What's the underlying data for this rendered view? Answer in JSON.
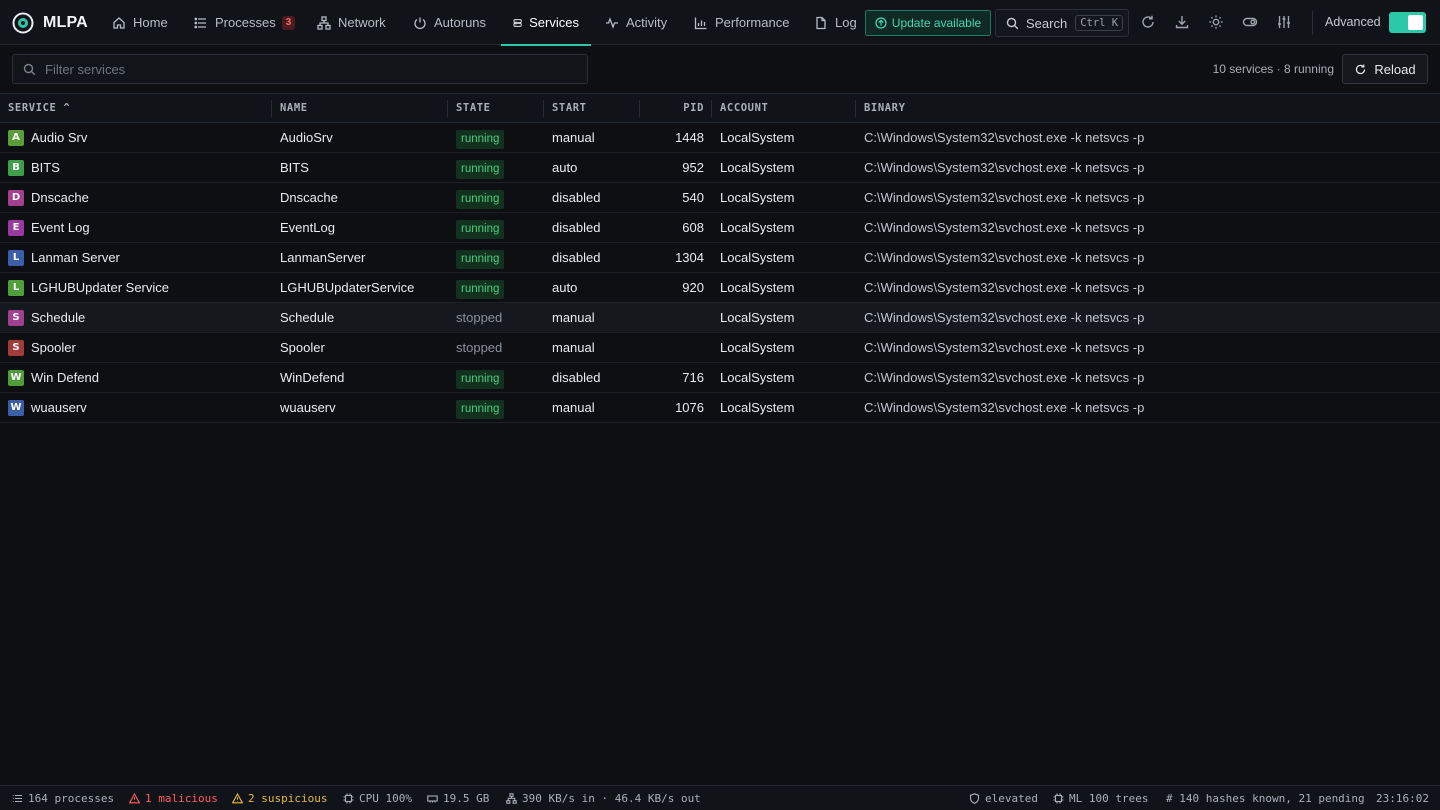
{
  "app": {
    "name": "MLPA"
  },
  "nav": {
    "tabs": [
      {
        "label": "Home",
        "icon": "home-icon"
      },
      {
        "label": "Processes",
        "icon": "list-icon",
        "badge": "3"
      },
      {
        "label": "Network",
        "icon": "network-icon"
      },
      {
        "label": "Autoruns",
        "icon": "power-icon"
      },
      {
        "label": "Services",
        "icon": "server-icon",
        "active": true
      },
      {
        "label": "Activity",
        "icon": "activity-icon"
      },
      {
        "label": "Performance",
        "icon": "bar-chart-icon"
      },
      {
        "label": "Log",
        "icon": "file-icon"
      }
    ],
    "update_label": "Update available",
    "search_label": "Search",
    "search_shortcut": "Ctrl K",
    "advanced_label": "Advanced",
    "advanced_on": true
  },
  "filter": {
    "placeholder": "Filter services",
    "summary": "10 services · 8 running",
    "reload_label": "Reload"
  },
  "table": {
    "headers": {
      "service": "SERVICE ^",
      "name": "NAME",
      "state": "STATE",
      "start": "START",
      "pid": "PID",
      "account": "ACCOUNT",
      "binary": "BINARY"
    },
    "rows": [
      {
        "letter": "A",
        "color": "#5a9e3a",
        "service": "Audio Srv",
        "name": "AudioSrv",
        "state": "running",
        "start": "manual",
        "pid": "1448",
        "account": "LocalSystem",
        "binary": "C:\\Windows\\System32\\svchost.exe -k netsvcs -p"
      },
      {
        "letter": "B",
        "color": "#3f9e4a",
        "service": "BITS",
        "name": "BITS",
        "state": "running",
        "start": "auto",
        "pid": "952",
        "account": "LocalSystem",
        "binary": "C:\\Windows\\System32\\svchost.exe -k netsvcs -p"
      },
      {
        "letter": "D",
        "color": "#a23f8e",
        "service": "Dnscache",
        "name": "Dnscache",
        "state": "running",
        "start": "disabled",
        "pid": "540",
        "account": "LocalSystem",
        "binary": "C:\\Windows\\System32\\svchost.exe -k netsvcs -p"
      },
      {
        "letter": "E",
        "color": "#9a3aa0",
        "service": "Event Log",
        "name": "EventLog",
        "state": "running",
        "start": "disabled",
        "pid": "608",
        "account": "LocalSystem",
        "binary": "C:\\Windows\\System32\\svchost.exe -k netsvcs -p"
      },
      {
        "letter": "L",
        "color": "#3c5ea8",
        "service": "Lanman Server",
        "name": "LanmanServer",
        "state": "running",
        "start": "disabled",
        "pid": "1304",
        "account": "LocalSystem",
        "binary": "C:\\Windows\\System32\\svchost.exe -k netsvcs -p"
      },
      {
        "letter": "L",
        "color": "#4f9e3a",
        "service": "LGHUBUpdater Service",
        "name": "LGHUBUpdaterService",
        "state": "running",
        "start": "auto",
        "pid": "920",
        "account": "LocalSystem",
        "binary": "C:\\Windows\\System32\\svchost.exe -k netsvcs -p"
      },
      {
        "letter": "S",
        "color": "#a0408e",
        "service": "Schedule",
        "name": "Schedule",
        "state": "stopped",
        "start": "manual",
        "pid": "",
        "account": "LocalSystem",
        "binary": "C:\\Windows\\System32\\svchost.exe -k netsvcs -p",
        "highlight": true
      },
      {
        "letter": "S",
        "color": "#a23c3c",
        "service": "Spooler",
        "name": "Spooler",
        "state": "stopped",
        "start": "manual",
        "pid": "",
        "account": "LocalSystem",
        "binary": "C:\\Windows\\System32\\svchost.exe -k netsvcs -p"
      },
      {
        "letter": "W",
        "color": "#4f9e3a",
        "service": "Win Defend",
        "name": "WinDefend",
        "state": "running",
        "start": "disabled",
        "pid": "716",
        "account": "LocalSystem",
        "binary": "C:\\Windows\\System32\\svchost.exe -k netsvcs -p"
      },
      {
        "letter": "W",
        "color": "#3c5ea8",
        "service": "wuauserv",
        "name": "wuauserv",
        "state": "running",
        "start": "manual",
        "pid": "1076",
        "account": "LocalSystem",
        "binary": "C:\\Windows\\System32\\svchost.exe -k netsvcs -p"
      }
    ]
  },
  "status": {
    "processes": "164 processes",
    "malicious": "1 malicious",
    "suspicious": "2 suspicious",
    "cpu": "CPU 100%",
    "memory": "19.5 GB",
    "network": "390 KB/s in · 46.4 KB/s out",
    "elevated": "elevated",
    "ml": "ML 100 trees",
    "hashes": "# 140 hashes known, 21 pending",
    "time": "23:16:02"
  }
}
